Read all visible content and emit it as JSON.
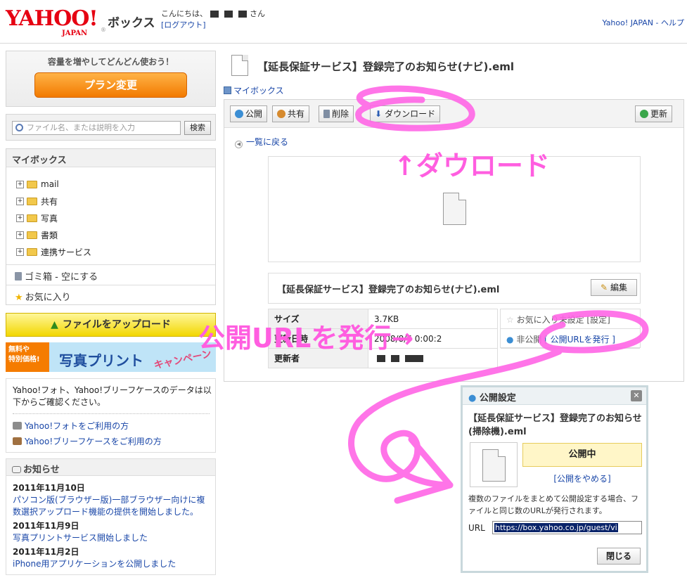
{
  "header": {
    "logo_text": "YAHOO!",
    "logo_sub": "JAPAN",
    "app_name": "ボックス",
    "greeting": "こんにちは、",
    "greeting_suffix": "さん",
    "logout": "[ログアウト]",
    "top_links": "Yahoo! JAPAN - ヘルプ"
  },
  "promo": {
    "text": "容量を増やしてどんどん使おう！",
    "button": "プラン変更"
  },
  "search": {
    "placeholder": "ファイル名、または説明を入力",
    "button": "検索"
  },
  "mybox": {
    "title": "マイボックス",
    "folders": [
      "mail",
      "共有",
      "写真",
      "書類",
      "連携サービス"
    ],
    "trash": "ゴミ箱",
    "trash_action": " - 空にする",
    "favorites": "お気に入り"
  },
  "upload_button": "ファイルをアップロード",
  "print_banner": {
    "badge1": "無料や",
    "badge2": "特別価格!",
    "title": "写真プリント",
    "campaign": "キャンペーン"
  },
  "info": {
    "text": "Yahoo!フォト、Yahoo!ブリーフケースのデータは以下からご確認ください。",
    "link1": "Yahoo!フォトをご利用の方",
    "link2": "Yahoo!ブリーフケースをご利用の方"
  },
  "news": {
    "title": "お知らせ",
    "items": [
      {
        "date": "2011年11月10日",
        "text": "パソコン版(ブラウザー版)一部ブラウザー向けに複数選択アップロード機能の提供を開始しました。"
      },
      {
        "date": "2011年11月9日",
        "text": "写真プリントサービス開始しました"
      },
      {
        "date": "2011年11月2日",
        "text": "iPhone用アプリケーションを公開しました"
      }
    ]
  },
  "file": {
    "title": "【延長保証サービス】登録完了のお知らせ(ナビ).eml",
    "breadcrumb": "マイボックス",
    "name": "【延長保証サービス】登録完了のお知らせ(ナビ).eml",
    "edit": "編集",
    "back": "一覧に戻る"
  },
  "toolbar": {
    "publish": "公開",
    "share": "共有",
    "delete": "削除",
    "download": "ダウンロード",
    "refresh": "更新"
  },
  "props": {
    "size_label": "サイズ",
    "size_value": "3.7KB",
    "updated_label": "更新日時",
    "updated_value": "2008/8/6 0:00:2",
    "updater_label": "更新者",
    "fav_setting": "お気に入り未設定 [設定]",
    "public_status": "非公開",
    "publish_url_link": "[ 公開URLを発行 ]"
  },
  "popup": {
    "title": "公開設定",
    "file_name": "【延長保証サービス】登録完了のお知らせ(掃除機).eml",
    "status": "公開中",
    "stop": "[公開をやめる]",
    "description": "複数のファイルをまとめて公開設定する場合、ファイルと同じ数のURLが発行されます。",
    "url_label": "URL",
    "url_value": "https://box.yahoo.co.jp/guest/vi",
    "close": "閉じる"
  },
  "annotations": {
    "download": "↑ダウロード",
    "publish_url": "公開URLを発行→"
  },
  "colors": {
    "annotation": "#ff5ee0",
    "brand": "#e60012",
    "link": "#1a47a8"
  }
}
